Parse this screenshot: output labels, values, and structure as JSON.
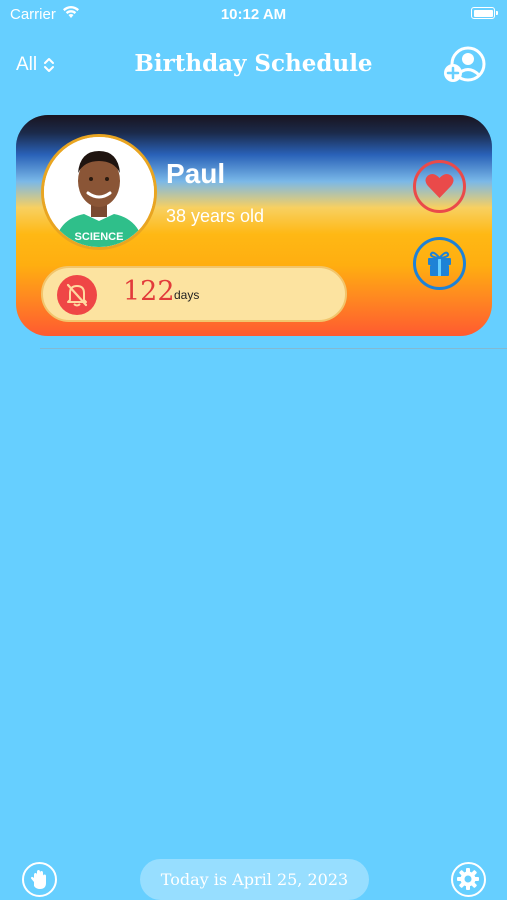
{
  "status_bar": {
    "carrier": "Carrier",
    "time": "10:12 AM"
  },
  "nav": {
    "filter_label": "All",
    "title": "Birthday Schedule",
    "add_icon": "person-add-icon"
  },
  "card": {
    "name": "Paul",
    "age": "38 years old",
    "shirt_text": "SCIENCE",
    "days_count": "122",
    "days_label": "days",
    "icons": [
      "bell-slash-icon",
      "heart-icon",
      "gift-icon"
    ]
  },
  "footer": {
    "today_text": "Today is April 25, 2023",
    "icons": [
      "hand-icon",
      "gear-icon"
    ]
  },
  "colors": {
    "background": "#66cfff",
    "heart_red": "#ea4a4a",
    "gift_blue": "#1e82d6",
    "days_red": "#e23b3b",
    "avatar_ring": "#e9a521"
  }
}
